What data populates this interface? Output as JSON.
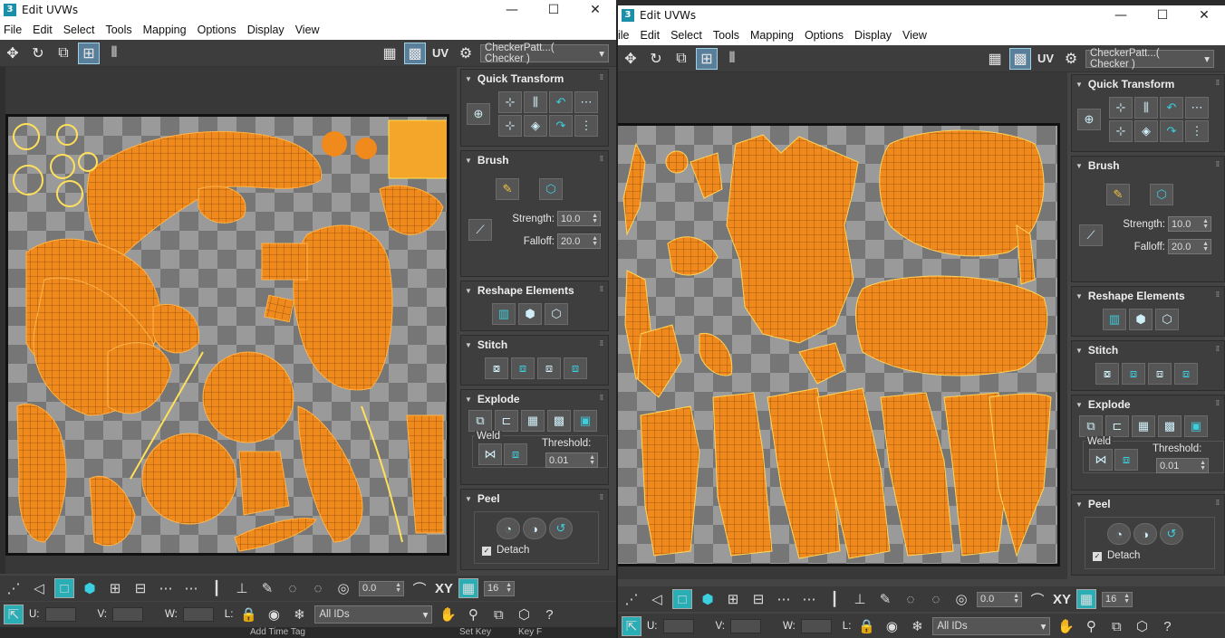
{
  "windows": [
    {
      "title": "Edit UVWs",
      "menu": [
        "File",
        "Edit",
        "Select",
        "Tools",
        "Mapping",
        "Options",
        "Display",
        "View"
      ],
      "uv_label": "UV",
      "checker_combo": "CheckerPatt...( Checker )",
      "rollouts": {
        "quick_transform": "Quick Transform",
        "brush": "Brush",
        "strength_label": "Strength:",
        "strength_value": "10.0",
        "falloff_label": "Falloff:",
        "falloff_value": "20.0",
        "reshape": "Reshape Elements",
        "stitch": "Stitch",
        "explode": "Explode",
        "weld": "Weld",
        "threshold_label": "Threshold:",
        "threshold_value": "0.01",
        "peel": "Peel",
        "detach": "Detach"
      },
      "bottom": {
        "angle_value": "0.0",
        "xy_label": "XY",
        "grid_value": "16",
        "u_label": "U:",
        "v_label": "V:",
        "w_label": "W:",
        "l_label": "L:",
        "ids_combo": "All IDs",
        "time_tag": "Add Time Tag",
        "set_key": "Set Key",
        "key_f": "Key F"
      }
    },
    {
      "title": "Edit UVWs",
      "menu": [
        "ile",
        "Edit",
        "Select",
        "Tools",
        "Mapping",
        "Options",
        "Display",
        "View"
      ],
      "uv_label": "UV",
      "checker_combo": "CheckerPatt...( Checker )",
      "rollouts": {
        "quick_transform": "Quick Transform",
        "brush": "Brush",
        "strength_label": "Strength:",
        "strength_value": "10.0",
        "falloff_label": "Falloff:",
        "falloff_value": "20.0",
        "reshape": "Reshape Elements",
        "stitch": "Stitch",
        "explode": "Explode",
        "weld": "Weld",
        "threshold_label": "Threshold:",
        "threshold_value": "0.01",
        "peel": "Peel",
        "detach": "Detach"
      },
      "bottom": {
        "angle_value": "0.0",
        "xy_label": "XY",
        "grid_value": "16",
        "u_label": "U:",
        "v_label": "V:",
        "w_label": "W:",
        "l_label": "L:",
        "ids_combo": "All IDs"
      }
    }
  ],
  "colors": {
    "uv_shell": "#f08a1c",
    "uv_edge": "#ffe05a",
    "accent": "#2aaeb6",
    "checker_dark": "#767676",
    "checker_light": "#9a9a9a"
  }
}
